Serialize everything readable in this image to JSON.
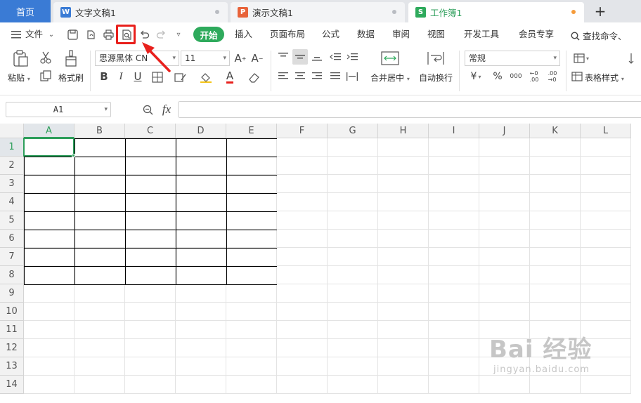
{
  "tabs": {
    "home": "首页",
    "docs": [
      {
        "label": "文字文稿1",
        "icon": "W",
        "color": "#3a7bd5"
      },
      {
        "label": "演示文稿1",
        "icon": "P",
        "color": "#e8633a"
      },
      {
        "label": "工作簿1",
        "icon": "S",
        "color": "#2eaa5c"
      }
    ],
    "new_tab": "+"
  },
  "menu": {
    "file": "文件",
    "items": [
      "开始",
      "插入",
      "页面布局",
      "公式",
      "数据",
      "审阅",
      "视图",
      "开发工具",
      "会员专享"
    ],
    "search": "查找命令、"
  },
  "ribbon": {
    "paste": "粘贴",
    "format_painter": "格式刷",
    "font_name": "思源黑体 CN",
    "font_size": "11",
    "merge_center": "合并居中",
    "wrap_text": "自动换行",
    "number_format": "常规",
    "table_style": "表格样式",
    "bold": "B",
    "italic": "I",
    "underline": "U",
    "currency": "¥",
    "percent": "%"
  },
  "formula_bar": {
    "name_box": "A1",
    "fx": "fx",
    "value": ""
  },
  "sheet": {
    "columns": [
      "A",
      "B",
      "C",
      "D",
      "E",
      "F",
      "G",
      "H",
      "I",
      "J",
      "K",
      "L"
    ],
    "rows": [
      "1",
      "2",
      "3",
      "4",
      "5",
      "6",
      "7",
      "8",
      "9",
      "10",
      "11",
      "12",
      "13",
      "14"
    ],
    "active_cell": "A1"
  },
  "watermark": {
    "main": "Bai 经验",
    "sub": "jingyan.baidu.com"
  },
  "colors": {
    "accent_green": "#2eaa5c",
    "home_blue": "#3a7bd5",
    "highlight_red": "#e8201c"
  }
}
